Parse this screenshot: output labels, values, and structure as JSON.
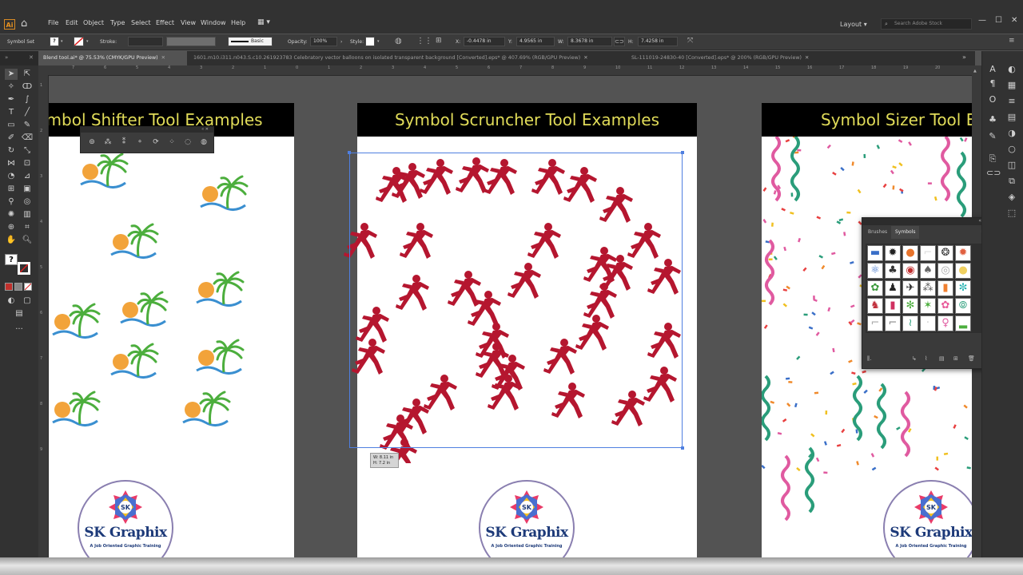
{
  "menubar": {
    "logo": "Ai",
    "items": [
      "File",
      "Edit",
      "Object",
      "Type",
      "Select",
      "Effect",
      "View",
      "Window",
      "Help"
    ],
    "layout_label": "Layout",
    "search_placeholder": "Search Adobe Stock"
  },
  "controlbar": {
    "selection_label": "Symbol Set",
    "stroke_label": "Stroke:",
    "brush_label": "Basic",
    "opacity_label": "Opacity:",
    "opacity_value": "100%",
    "style_label": "Style:",
    "x_label": "X:",
    "x_value": "-0.4478 in",
    "y_label": "Y:",
    "y_value": "4.9565 in",
    "w_label": "W:",
    "w_value": "8.3678 in",
    "h_label": "H:",
    "h_value": "7.4258 in"
  },
  "tabs": [
    {
      "label": "Blend tool.ai* @ 75.53% (CMYK/GPU Preview)",
      "active": true
    },
    {
      "label": "1601.m10.i311.n043.S.c10.261923783 Celebratory vector balloons on isolated transparent background [Converted].eps* @ 407.69% (RGB/GPU Preview)",
      "active": false
    },
    {
      "label": "SL-111019-24830-40 [Converted].eps* @ 200% (RGB/GPU Preview)",
      "active": false
    }
  ],
  "ruler": {
    "top_ticks": [
      "7",
      "6",
      "5",
      "4",
      "3",
      "2",
      "1",
      "0",
      "1",
      "2",
      "3",
      "4",
      "5",
      "6",
      "7",
      "8",
      "9",
      "10",
      "11",
      "12",
      "13",
      "14",
      "15",
      "16",
      "17",
      "18",
      "19",
      "20"
    ],
    "left_ticks": [
      "1",
      "2",
      "3",
      "4",
      "5",
      "6",
      "7",
      "8",
      "9"
    ]
  },
  "artboards": [
    {
      "title": "Symbol Shifter Tool Examples"
    },
    {
      "title": "Symbol Scruncher Tool Examples"
    },
    {
      "title": "Symbol Sizer Tool Examples"
    }
  ],
  "logo": {
    "brand": "SK Graphix",
    "tagline": "A Job Oriented Graphic Training",
    "mark_text": "SK"
  },
  "measure": {
    "w": "W: 8.11 in",
    "h": "H: 7.2 in"
  },
  "panel": {
    "tabs": [
      "Brushes",
      "Symbols"
    ],
    "active_tab": "Symbols"
  },
  "colors": {
    "runner": "#b5162f",
    "header_text": "#e1dc59",
    "palm": "#4cae3d",
    "sun": "#f2a33a",
    "wave": "#3a8fd0"
  }
}
